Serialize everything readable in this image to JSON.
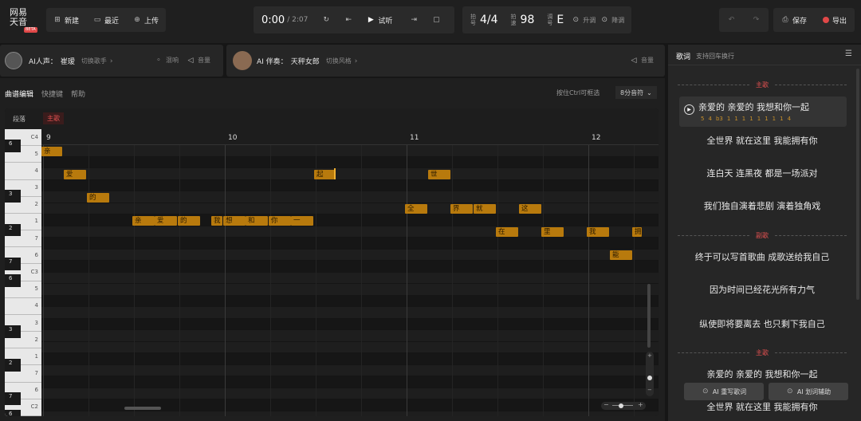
{
  "logo": {
    "line1": "网易",
    "line2": "天音",
    "badge": "BETA"
  },
  "toolbar": {
    "new": "新建",
    "recent": "最近",
    "upload": "上传",
    "time": "0:00",
    "duration": "/ 2:07",
    "audition": "试听",
    "beat_label": "拍号",
    "beat": "4/4",
    "tempo_label": "拍速",
    "tempo": "98",
    "key_label": "调号",
    "key": "E",
    "transpose_up": "升调",
    "transpose_down": "降调",
    "save": "保存",
    "export": "导出"
  },
  "tracks": {
    "vocal_label": "AI人声：",
    "vocal_name": "崔瑷",
    "switch_singer": "切换歌手",
    "mix": "混响",
    "volume1": "音量",
    "accomp_label": "AI 伴奏：",
    "accomp_name": "天秤女郎",
    "switch_style": "切换风格",
    "volume2": "音量"
  },
  "editor": {
    "title": "曲谱编辑",
    "shortcuts": "快捷键",
    "help": "帮助",
    "hint": "按住Ctrl可框选",
    "note_value": "8分音符",
    "tab_section": "段落",
    "tab_main": "主歌"
  },
  "ruler": [
    "9",
    "10",
    "11",
    "12"
  ],
  "piano": {
    "labels": [
      "C4",
      "5",
      "4",
      "3",
      "2",
      "1",
      "7",
      "6",
      "C3",
      "5",
      "4",
      "3",
      "2",
      "1",
      "7",
      "6",
      "C2"
    ],
    "badges": [
      "6",
      "3",
      "2",
      "7",
      "6",
      "3",
      "2",
      "7",
      "6"
    ]
  },
  "notes": [
    "亲",
    "爱",
    "的",
    "亲",
    "爱",
    "的",
    "我",
    "想",
    "和",
    "你",
    "一",
    "起",
    "世",
    "全",
    "界",
    "就",
    "这",
    "在",
    "里",
    "我",
    "拥",
    "能"
  ],
  "lyrics_panel": {
    "title": "歌词",
    "subtitle": "支持回车换行",
    "sections": [
      "主歌",
      "副歌",
      "主歌"
    ],
    "lines": [
      "亲爱的 亲爱的 我想和你一起",
      "全世界 就在这里 我能拥有你",
      "连白天 连黑夜 都是一场派对",
      "我们独自演着悲剧 演着独角戏",
      "终于可以写首歌曲 成歌送给我自己",
      "因为时间已经花光所有力气",
      "纵使即将要离去 也只剩下我自己",
      "亲爱的 亲爱的 我想和你一起",
      "全世界 就在这里 我能拥有你"
    ],
    "pitch_row": [
      "5",
      "4",
      "b3",
      "1",
      "1",
      "1",
      "1",
      "1",
      "1",
      "1",
      "1",
      "4"
    ],
    "rewrite": "AI 重写歌词",
    "assist": "AI 划词辅助"
  },
  "colors": {
    "accent": "#b87a0d",
    "red": "#e04848"
  }
}
